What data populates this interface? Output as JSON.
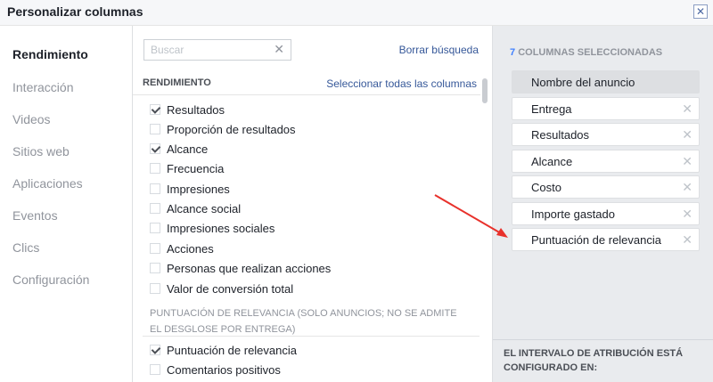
{
  "window": {
    "title": "Personalizar columnas",
    "close_icon": "close-icon"
  },
  "sidebar": {
    "items": [
      {
        "label": "Rendimiento",
        "active": true
      },
      {
        "label": "Interacción"
      },
      {
        "label": "Videos"
      },
      {
        "label": "Sitios web"
      },
      {
        "label": "Aplicaciones"
      },
      {
        "label": "Eventos"
      },
      {
        "label": "Clics"
      },
      {
        "label": "Configuración"
      }
    ]
  },
  "search": {
    "placeholder": "Buscar",
    "value": "",
    "clear_label": "Borrar búsqueda"
  },
  "section": {
    "title": "RENDIMIENTO",
    "select_all": "Seleccionar todas las columnas",
    "options": [
      {
        "label": "Resultados",
        "checked": true
      },
      {
        "label": "Proporción de resultados",
        "checked": false
      },
      {
        "label": "Alcance",
        "checked": true
      },
      {
        "label": "Frecuencia",
        "checked": false
      },
      {
        "label": "Impresiones",
        "checked": false
      },
      {
        "label": "Alcance social",
        "checked": false
      },
      {
        "label": "Impresiones sociales",
        "checked": false
      },
      {
        "label": "Acciones",
        "checked": false
      },
      {
        "label": "Personas que realizan acciones",
        "checked": false
      },
      {
        "label": "Valor de conversión total",
        "checked": false
      }
    ],
    "relevance_title_line1": "PUNTUACIÓN DE RELEVANCIA (SOLO ANUNCIOS; NO SE ADMITE",
    "relevance_title_line2": "EL DESGLOSE POR ENTREGA)",
    "relevance_options": [
      {
        "label": "Puntuación de relevancia",
        "checked": true
      },
      {
        "label": "Comentarios positivos",
        "checked": false
      }
    ]
  },
  "selected": {
    "count": "7",
    "count_label": "COLUMNAS SELECCIONADAS",
    "columns": [
      {
        "label": "Nombre del anuncio",
        "removable": false
      },
      {
        "label": "Entrega",
        "removable": true
      },
      {
        "label": "Resultados",
        "removable": true
      },
      {
        "label": "Alcance",
        "removable": true
      },
      {
        "label": "Costo",
        "removable": true
      },
      {
        "label": "Importe gastado",
        "removable": true
      },
      {
        "label": "Puntuación de relevancia",
        "removable": true
      }
    ],
    "remove_glyph": "✕",
    "attribution_line1": "EL INTERVALO DE ATRIBUCIÓN ESTÁ",
    "attribution_line2": "CONFIGURADO EN:"
  },
  "colors": {
    "accent": "#4080ff",
    "link": "#365899",
    "annotation_arrow": "#e8312b"
  }
}
